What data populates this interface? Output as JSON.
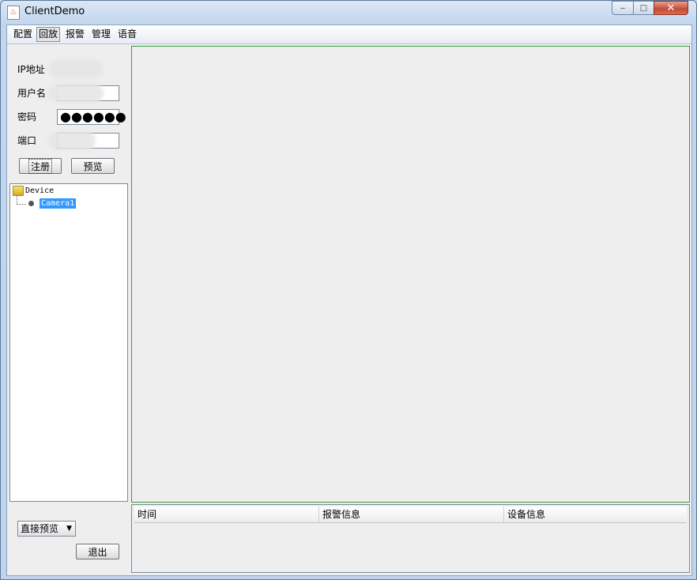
{
  "window": {
    "title": "ClientDemo",
    "minimize_glyph": "‒",
    "maximize_glyph": "□",
    "close_glyph": "✕"
  },
  "menu": {
    "items": [
      {
        "label": "配置"
      },
      {
        "label": "回放"
      },
      {
        "label": "报警"
      },
      {
        "label": "管理"
      },
      {
        "label": "语音"
      }
    ]
  },
  "login": {
    "ip_label": "IP地址",
    "username_label": "用户名",
    "password_label": "密码",
    "password_value": "●●●●●●",
    "port_label": "端口",
    "register_button": "注册",
    "preview_button": "预览"
  },
  "tree": {
    "root": "Device",
    "children": [
      "Camera1"
    ]
  },
  "preview_mode": {
    "selected": "直接预览"
  },
  "exit_button": "退出",
  "alarm_table": {
    "columns": [
      "时间",
      "报警信息",
      "设备信息"
    ]
  }
}
